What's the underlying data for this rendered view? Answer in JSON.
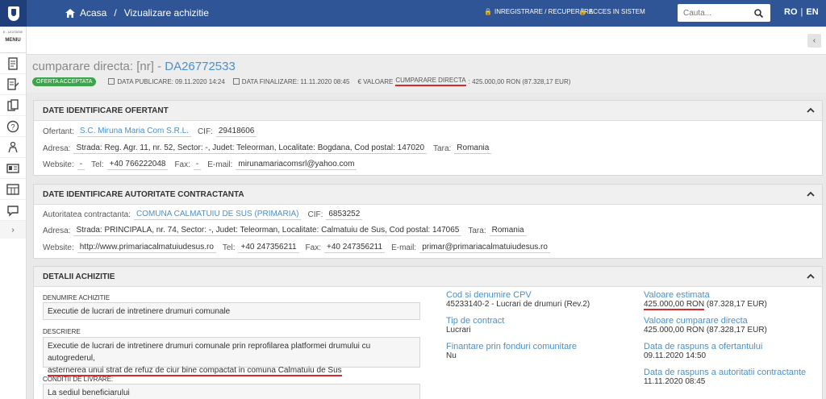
{
  "topbar": {
    "breadcrumb_home": "Acasa",
    "breadcrumb_sep": "/",
    "breadcrumb_current": "Vizualizare achizitie",
    "register_label": "INREGISTRARE / RECUPERARE",
    "login_label": "ACCES IN SISTEM",
    "search_placeholder": "Cauta...",
    "lang_ro": "RO",
    "lang_sep": "|",
    "lang_en": "EN"
  },
  "sidebar": {
    "top_small": "E - LICITATIE",
    "menu_label": "MENIU",
    "chevron": "›",
    "items": [
      "document-icon",
      "form-icon",
      "copy-icon",
      "help-icon",
      "tree-icon",
      "id-card-icon",
      "grid-icon",
      "chat-icon"
    ]
  },
  "subbar": {
    "collapse": "‹"
  },
  "header": {
    "title_prefix": "cumparare directa: [nr] - ",
    "title_code": "DA26772533",
    "status_badge": "OFERTA ACCEPTATA",
    "publish_label": "DATA PUBLICARE: 09.11.2020 14:24",
    "finish_label": "DATA FINALIZARE: 11.11.2020 08:45",
    "value_prefix": "€ VALOARE ",
    "value_underlined": "CUMPARARE DIRECTA",
    "value_suffix": ": 425.000,00  RON (87.328,17  EUR)"
  },
  "ofertant": {
    "title": "DATE IDENTIFICARE OFERTANT",
    "ofertant_label": "Ofertant:",
    "ofertant_value": "S.C. Miruna Maria Com S.R.L.",
    "cif_label": "CIF:",
    "cif_value": "29418606",
    "adresa_label": "Adresa:",
    "adresa_value": "Strada: Reg. Agr. 11, nr. 52, Sector: -, Judet: Teleorman, Localitate: Bogdana, Cod postal: 147020",
    "tara_label": "Tara:",
    "tara_value": "Romania",
    "website_label": "Website:",
    "website_value": "-",
    "tel_label": "Tel:",
    "tel_value": "+40 766222048",
    "fax_label": "Fax:",
    "fax_value": "-",
    "email_label": "E-mail:",
    "email_value": "mirunamariacomsrl@yahoo.com"
  },
  "autoritate": {
    "title": "DATE IDENTIFICARE AUTORITATE CONTRACTANTA",
    "aut_label": "Autoritatea contractanta:",
    "aut_value": "COMUNA CALMATUIU DE SUS (PRIMARIA)",
    "cif_label": "CIF:",
    "cif_value": "6853252",
    "adresa_label": "Adresa:",
    "adresa_value": "Strada: PRINCIPALA, nr. 74, Sector: -, Judet: Teleorman, Localitate: Calmatuiu de Sus, Cod postal: 147065",
    "tara_label": "Tara:",
    "tara_value": "Romania",
    "website_label": "Website:",
    "website_value": "http://www.primariacalmatuiudesus.ro",
    "tel_label": "Tel:",
    "tel_value": "+40 247356211",
    "fax_label": "Fax:",
    "fax_value": "+40 247356211",
    "email_label": "E-mail:",
    "email_value": "primar@primariacalmatuiudesus.ro"
  },
  "detalii": {
    "title": "DETALII ACHIZITIE",
    "denumire_label": "DENUMIRE ACHIZITIE",
    "denumire_value": "Executie de lucrari de intretinere drumuri comunale",
    "descriere_label": "DESCRIERE",
    "descriere_line1": "Executie de lucrari de intretinere drumuri comunale prin reprofilarea platformei drumului cu autogrederul,",
    "descriere_line2": "asternerea unui strat de refuz de ciur bine compactat in comuna Calmatuiu de Sus",
    "conditii_label": "CONDITII DE LIVRARE:",
    "conditii_value": "La sediul beneficiarului",
    "cpv_label": "Cod si denumire CPV",
    "cpv_value": "45233140-2 - Lucrari de drumuri (Rev.2)",
    "tip_label": "Tip de contract",
    "tip_value": "Lucrari",
    "fin_label": "Finantare prin fonduri comunitare",
    "fin_value": "Nu",
    "val_est_label": "Valoare estimata",
    "val_est_amount": "425.000,00  RON",
    "val_est_eur": " (87.328,17  EUR)",
    "val_cump_label": "Valoare cumparare directa",
    "val_cump_value": "425.000,00  RON (87.328,17  EUR)",
    "raspuns_of_label": "Data de raspuns a ofertantului",
    "raspuns_of_value": "09.11.2020 14:50",
    "raspuns_aut_label": "Data de raspuns a autoritatii contractante",
    "raspuns_aut_value": "11.11.2020 08:45"
  },
  "colors": {
    "topbar": "#2f5597",
    "badge": "#3aa54a",
    "link": "#4a90c9",
    "highlight": "#d9292a"
  }
}
